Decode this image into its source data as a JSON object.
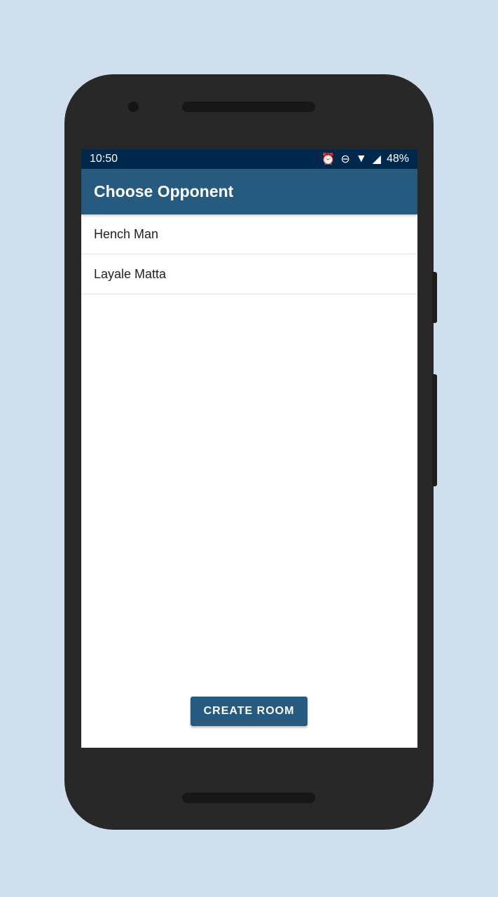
{
  "status": {
    "time": "10:50",
    "battery": "48%"
  },
  "appbar": {
    "title": "Choose Opponent"
  },
  "opponents": [
    {
      "name": "Hench Man"
    },
    {
      "name": "Layale Matta"
    }
  ],
  "actions": {
    "create_room": "CREATE ROOM"
  }
}
